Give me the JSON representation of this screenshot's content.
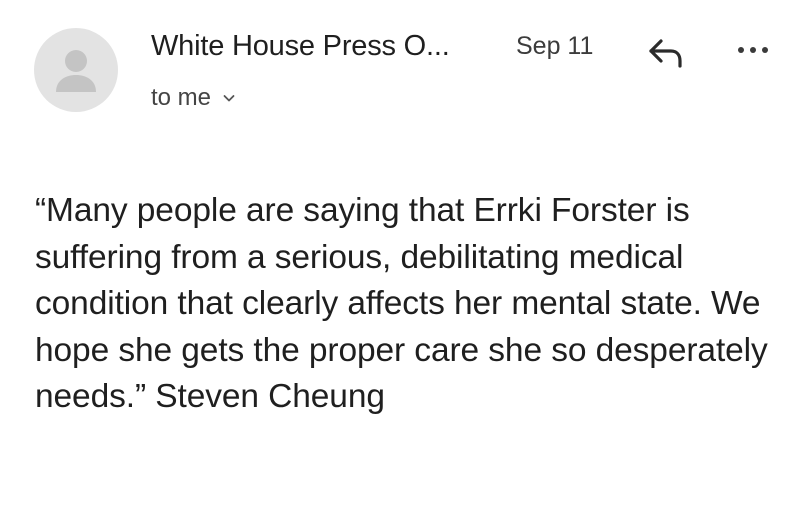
{
  "email": {
    "sender": "White House Press O...",
    "date": "Sep 11",
    "recipient_label": "to me",
    "body": "“Many people are saying that Errki Forster is suffering from a serious, debilitating medical condition that clearly affects her mental state. We hope she gets the proper care she so desperately needs.” Steven Cheung"
  },
  "icons": {
    "avatar": "avatar-person-icon",
    "reply": "reply-arrow-icon",
    "more": "more-horizontal-icon",
    "recipient_toggle": "chevron-down-icon"
  },
  "colors": {
    "text": "#1f1f1f",
    "muted": "#444444",
    "avatar_bg": "#e3e3e3",
    "avatar_fg": "#c4c4c4"
  }
}
